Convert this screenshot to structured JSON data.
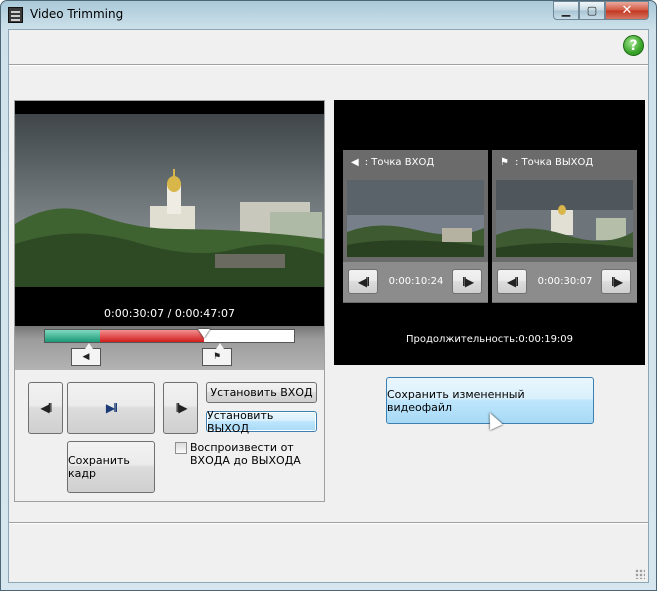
{
  "window": {
    "title": "Video Trimming",
    "minimize_icon": "minimize-icon",
    "maximize_icon": "maximize-icon",
    "close_icon": "close-icon",
    "help_label": "?"
  },
  "player": {
    "timecode": "0:00:30:07 / 0:00:47:07",
    "progress": {
      "in_fraction": 0.22,
      "out_fraction": 0.64
    },
    "controls": {
      "prev_frame_glyph": "◀II",
      "play_pause_glyph": "▶II",
      "next_frame_glyph": "II▶",
      "set_in_label": "Установить ВХОД",
      "set_out_label": "Установить ВЫХОД",
      "save_frame_label": "Сохранить кадр",
      "play_in_out_label": "Воспроизвести от ВХОДА до ВЫХОДА",
      "play_in_out_checked": false
    }
  },
  "preview": {
    "in_point": {
      "label": ": Точка ВХОД",
      "time": "0:00:10:24"
    },
    "out_point": {
      "label": ": Точка ВЫХОД",
      "time": "0:00:30:07"
    },
    "duration": "Продолжительность:0:00:19:09"
  },
  "save_video_label": "Сохранить измененный видеофайл",
  "colors": {
    "in_progress": "#1a9a78",
    "out_progress": "#d11d1d",
    "help": "#3aa52a",
    "focus": "#3c7fb1"
  }
}
